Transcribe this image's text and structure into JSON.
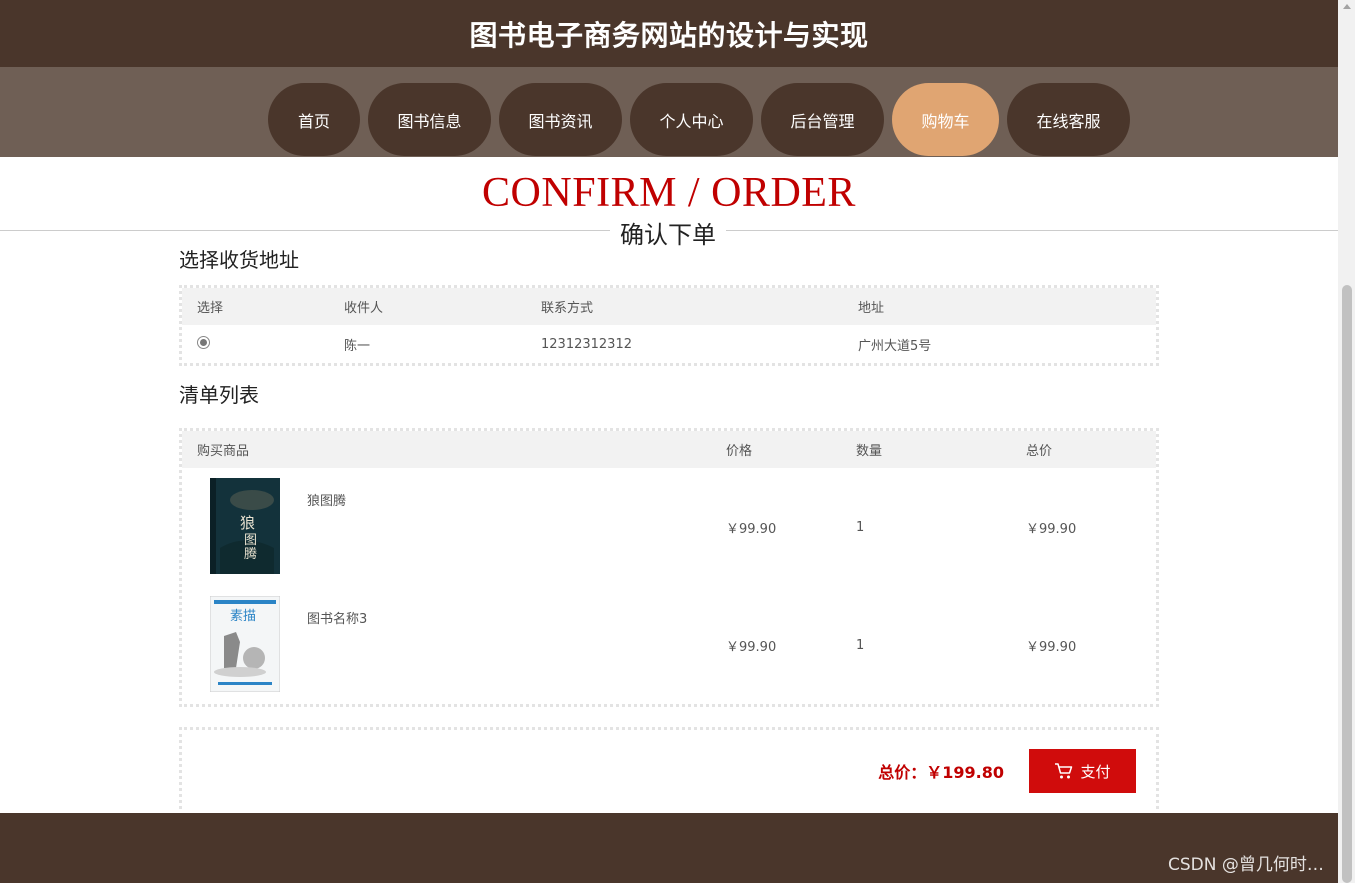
{
  "header": {
    "title": "图书电子商务网站的设计与实现"
  },
  "nav": {
    "items": [
      {
        "label": "首页"
      },
      {
        "label": "图书信息"
      },
      {
        "label": "图书资讯"
      },
      {
        "label": "个人中心"
      },
      {
        "label": "后台管理"
      },
      {
        "label": "购物车"
      },
      {
        "label": "在线客服"
      }
    ],
    "active_index": 5
  },
  "confirm": {
    "title_en": "CONFIRM / ORDER",
    "title_cn": "确认下单"
  },
  "address": {
    "title": "选择收货地址",
    "columns": [
      "选择",
      "收件人",
      "联系方式",
      "地址"
    ],
    "rows": [
      {
        "selected": true,
        "name": "陈一",
        "phone": "12312312312",
        "address": "广州大道5号"
      }
    ]
  },
  "order_list": {
    "title": "清单列表",
    "columns": [
      "购买商品",
      "价格",
      "数量",
      "总价"
    ],
    "items": [
      {
        "name": "狼图腾",
        "price": "￥99.90",
        "qty": "1",
        "total": "￥99.90"
      },
      {
        "name": "图书名称3",
        "price": "￥99.90",
        "qty": "1",
        "total": "￥99.90"
      }
    ]
  },
  "summary": {
    "total_label": "总价：",
    "total_value": "￥199.80",
    "pay_label": "支付"
  },
  "colors": {
    "header": "#4a362b",
    "nav": "#6f5f55",
    "active": "#e0a572",
    "accent": "#c00000",
    "pay": "#d00c0c"
  },
  "icons": {
    "pay": "cart-icon"
  },
  "watermark": "CSDN @曾几何时…"
}
